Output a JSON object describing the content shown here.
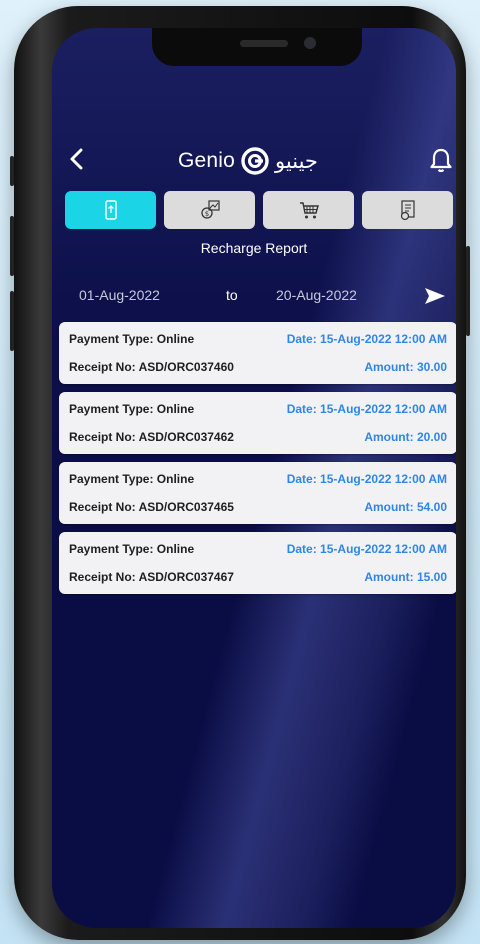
{
  "header": {
    "brand_en": "Genio",
    "brand_ar": "جينيو"
  },
  "page": {
    "subtitle": "Recharge Report"
  },
  "filter": {
    "from_date": "01-Aug-2022",
    "separator": "to",
    "to_date": "20-Aug-2022"
  },
  "tabs": [
    {
      "icon": "mobile-recharge-icon",
      "active": true
    },
    {
      "icon": "money-chart-icon",
      "active": false
    },
    {
      "icon": "shopping-cart-icon",
      "active": false
    },
    {
      "icon": "document-report-icon",
      "active": false
    }
  ],
  "records": [
    {
      "payment_type": "Payment Type: Online",
      "date": "Date: 15-Aug-2022 12:00 AM",
      "receipt": "Receipt No: ASD/ORC037460",
      "amount": "Amount: 30.00"
    },
    {
      "payment_type": "Payment Type: Online",
      "date": "Date: 15-Aug-2022 12:00 AM",
      "receipt": "Receipt No: ASD/ORC037462",
      "amount": "Amount: 20.00"
    },
    {
      "payment_type": "Payment Type: Online",
      "date": "Date: 15-Aug-2022 12:00 AM",
      "receipt": "Receipt No: ASD/ORC037465",
      "amount": "Amount: 54.00"
    },
    {
      "payment_type": "Payment Type: Online",
      "date": "Date: 15-Aug-2022 12:00 AM",
      "receipt": "Receipt No: ASD/ORC037467",
      "amount": "Amount: 15.00"
    }
  ],
  "colors": {
    "accent": "#1bd4e6",
    "link": "#2f86e8",
    "background": "#0a0d44"
  }
}
